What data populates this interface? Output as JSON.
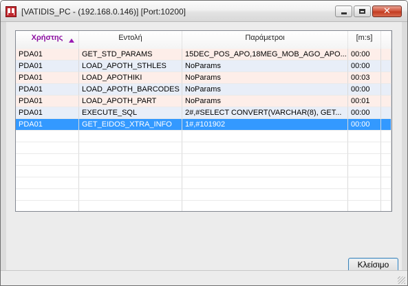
{
  "window": {
    "title": "[VATIDIS_PC - (192.168.0.146)] [Port:10200]"
  },
  "grid": {
    "columns": [
      {
        "label": "Χρήστης",
        "sorted": "ascending"
      },
      {
        "label": "Εντολή"
      },
      {
        "label": "Παράμετροι"
      },
      {
        "label": "[m:s]"
      }
    ],
    "rows": [
      {
        "user": "PDA01",
        "command": "GET_STD_PARAMS",
        "params": "15DEC_POS_APO,18MEG_MOB_AGO_APO...",
        "time": "00:00"
      },
      {
        "user": "PDA01",
        "command": "LOAD_APOTH_STHLES",
        "params": "NoParams",
        "time": "00:00"
      },
      {
        "user": "PDA01",
        "command": "LOAD_APOTHIKI",
        "params": "NoParams",
        "time": "00:03"
      },
      {
        "user": "PDA01",
        "command": "LOAD_APOTH_BARCODES",
        "params": "NoParams",
        "time": "00:00"
      },
      {
        "user": "PDA01",
        "command": "LOAD_APOTH_PART",
        "params": "NoParams",
        "time": "00:01"
      },
      {
        "user": "PDA01",
        "command": "EXECUTE_SQL",
        "params": "2#,#SELECT CONVERT(VARCHAR(8), GET...",
        "time": "00:00"
      },
      {
        "user": "PDA01",
        "command": "GET_EIDOS_XTRA_INFO",
        "params": "1#,#101902",
        "time": "00:00"
      }
    ],
    "selected_index": 6
  },
  "buttons": {
    "close_label": "Κλείσιμο"
  },
  "colors": {
    "selection": "#3399ff",
    "row_even": "#fdeee9",
    "row_odd": "#e8eef8",
    "sorted_header": "#8b0ca0"
  }
}
